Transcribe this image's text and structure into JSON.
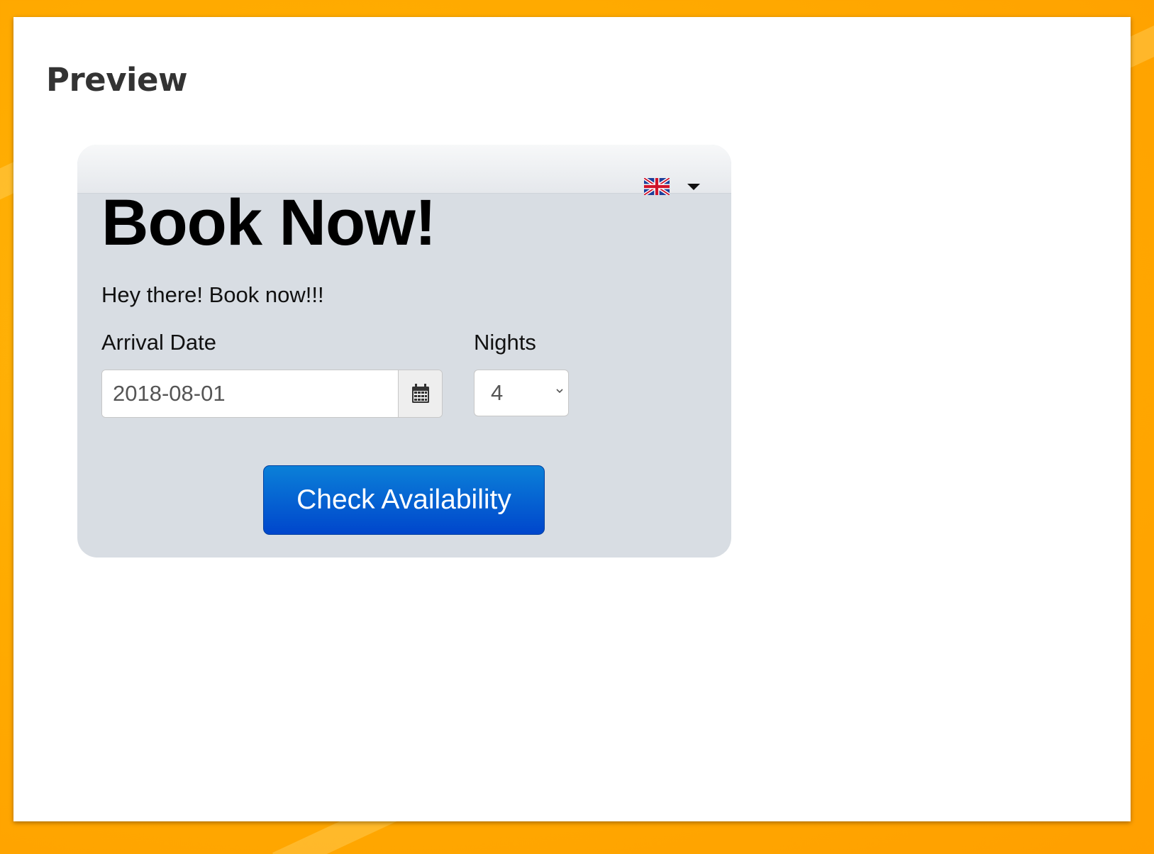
{
  "page": {
    "title": "Preview"
  },
  "widget": {
    "title": "Book Now!",
    "subtitle": "Hey there! Book now!!!",
    "language": {
      "icon": "uk-flag-icon",
      "caret_icon": "caret-down-icon"
    },
    "arrival": {
      "label": "Arrival Date",
      "value": "2018-08-01",
      "calendar_icon": "calendar-icon"
    },
    "nights": {
      "label": "Nights",
      "value": "4"
    },
    "submit_label": "Check Availability"
  },
  "colors": {
    "background": "#ffab00",
    "widget_background": "#d8dde3",
    "button_top": "#0b80d8",
    "button_bottom": "#0046cc",
    "heading_text": "#333333"
  }
}
